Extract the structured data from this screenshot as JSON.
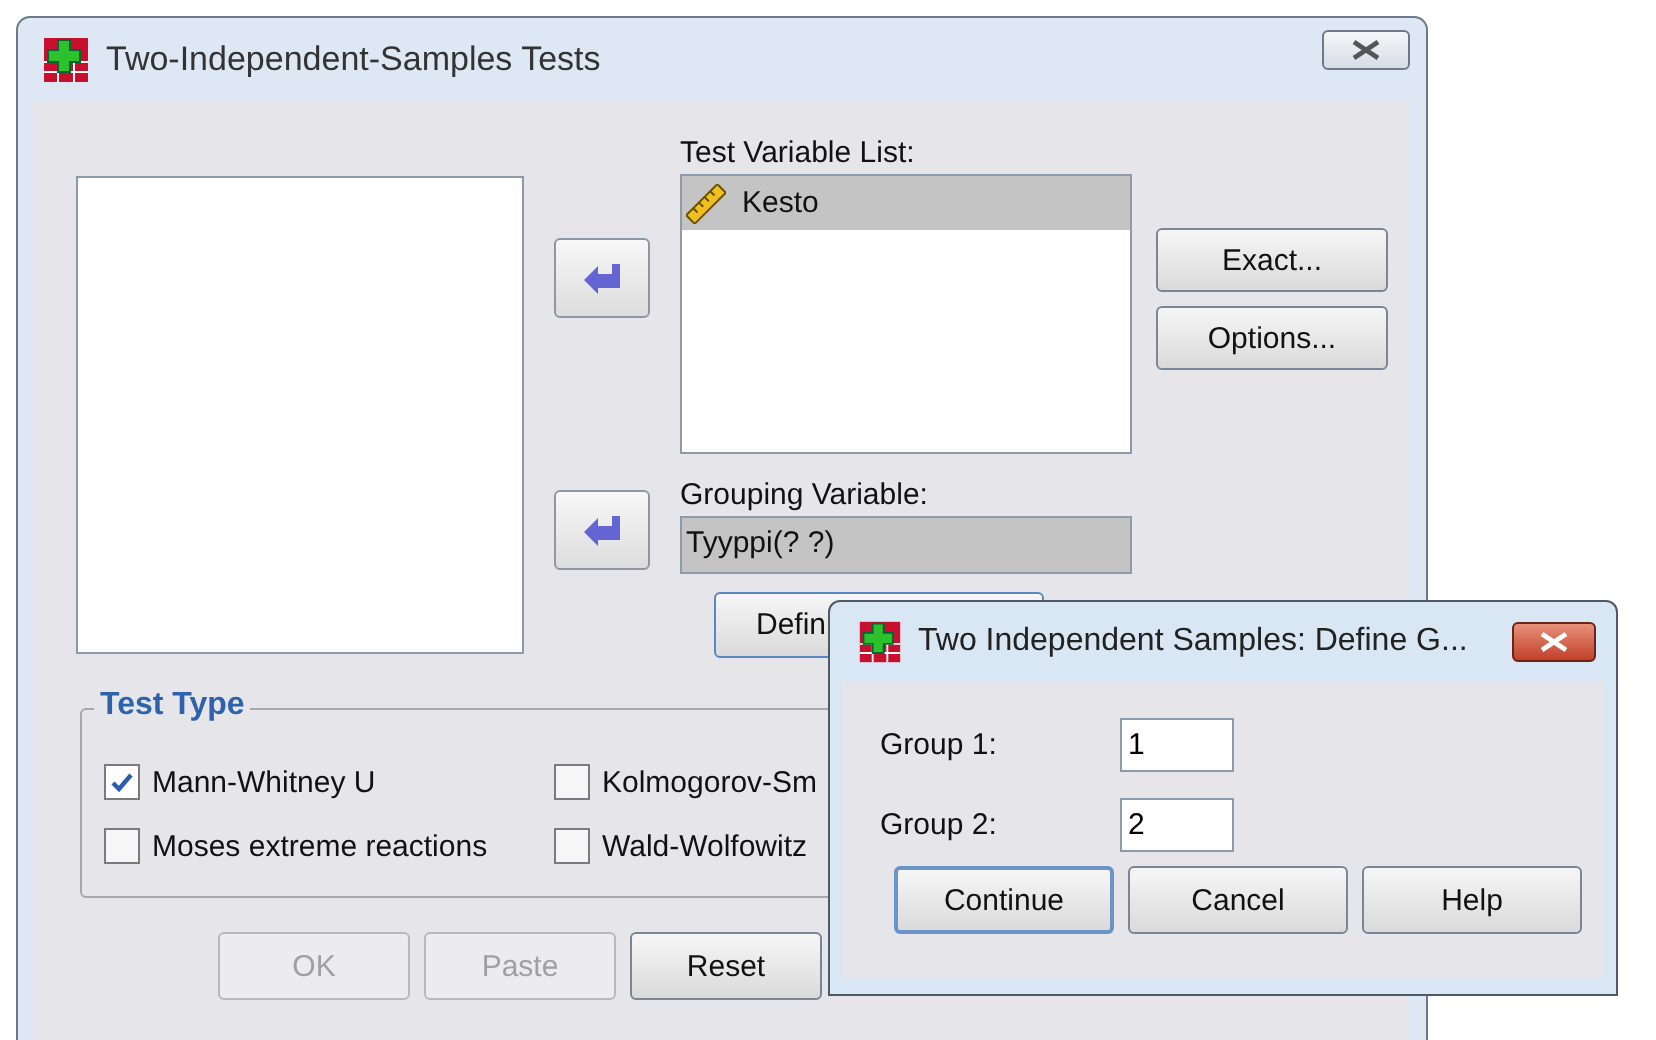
{
  "window": {
    "title": "Two-Independent-Samples Tests"
  },
  "test_variable_list": {
    "label": "Test Variable List:",
    "items": [
      {
        "name": "Kesto",
        "selected": true
      }
    ]
  },
  "grouping_variable": {
    "label": "Grouping Variable:",
    "value": "Tyyppi(? ?)"
  },
  "define_button": "Defin",
  "side_buttons": [
    "Exact...",
    "Options..."
  ],
  "test_type": {
    "title": "Test Type",
    "options": [
      {
        "label": "Mann-Whitney U",
        "checked": true
      },
      {
        "label": "Kolmogorov-Sm",
        "checked": false
      },
      {
        "label": "Moses extreme reactions",
        "checked": false
      },
      {
        "label": "Wald-Wolfowitz",
        "checked": false
      }
    ]
  },
  "buttons": [
    {
      "label": "OK",
      "disabled": true
    },
    {
      "label": "Paste",
      "disabled": true
    },
    {
      "label": "Reset",
      "disabled": false
    }
  ],
  "define_groups": {
    "title": "Two Independent Samples: Define G...",
    "fields": [
      {
        "label": "Group 1:",
        "value": "1"
      },
      {
        "label": "Group 2:",
        "value": "2"
      }
    ],
    "buttons": [
      {
        "label": "Continue",
        "default": true
      },
      {
        "label": "Cancel",
        "default": false
      },
      {
        "label": "Help",
        "default": false
      }
    ]
  }
}
